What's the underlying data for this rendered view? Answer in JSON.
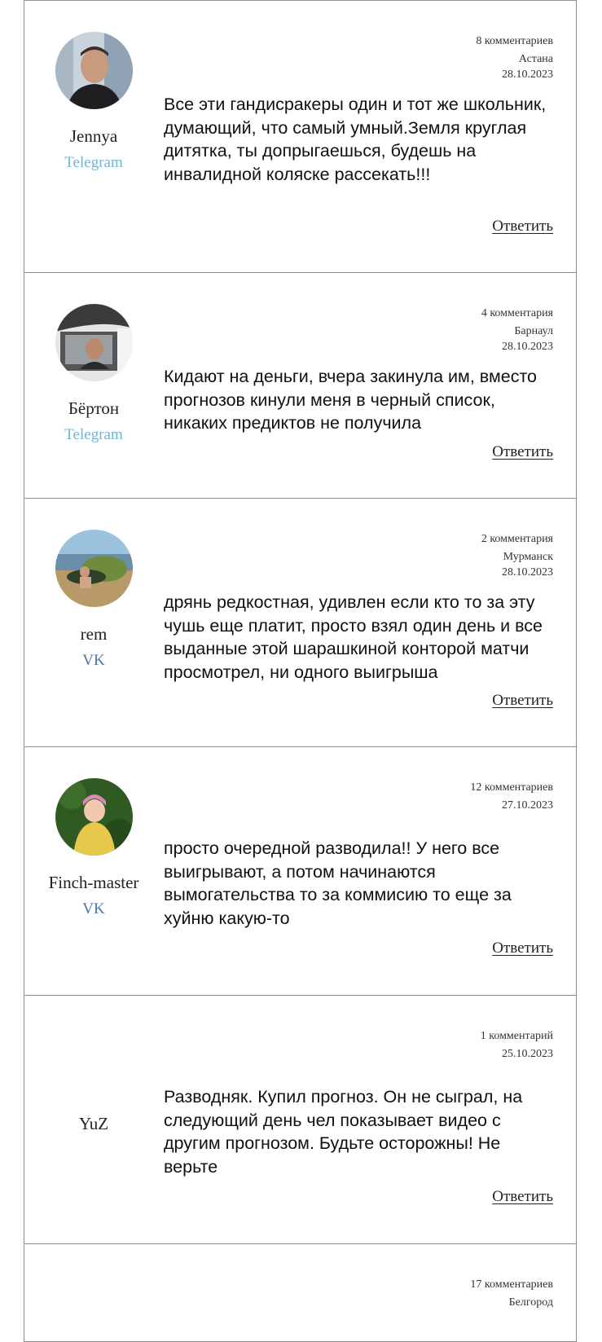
{
  "comments": [
    {
      "author": "Jennya",
      "source": "Telegram",
      "count": "8 комментариев",
      "city": "Астана",
      "date": "28.10.2023",
      "text": "Все эти гандисракеры один и тот же школьник, думающий, что самый умный.Земля круглая дитятка, ты допрыгаешься, будешь на инвалидной коляске рассекать!!!",
      "reply": "Ответить"
    },
    {
      "author": "Бёртон",
      "source": "Telegram",
      "count": "4 комментария",
      "city": "Барнаул",
      "date": "28.10.2023",
      "text": "Кидают на деньги, вчера закинула им, вместо прогнозов кинули меня в черный список, никаких предиктов не получила",
      "reply": "Ответить"
    },
    {
      "author": "rem",
      "source": "VK",
      "count": "2 комментария",
      "city": "Мурманск",
      "date": "28.10.2023",
      "text": "дрянь редкостная, удивлен если кто то за эту чушь еще платит, просто взял один день и все выданные этой шарашкиной конторой матчи просмотрел, ни одного выигрыша",
      "reply": "Ответить"
    },
    {
      "author": "Finch-master",
      "source": "VK",
      "count": "12 комментариев",
      "date": "27.10.2023",
      "text": "просто очередной разводила!! У него все выигрывают, а потом начинаются вымогательства то за коммисию то еще за хуйню какую-то",
      "reply": "Ответить"
    },
    {
      "author": "YuZ",
      "count": "1 комментарий",
      "date": "25.10.2023",
      "text": "Разводняк. Купил прогноз. Он не сыграл, на следующий день чел показывает видео с другим прогнозом. Будьте осторожны! Не верьте",
      "reply": "Ответить"
    },
    {
      "count": "17 комментариев",
      "city": "Белгород"
    }
  ]
}
